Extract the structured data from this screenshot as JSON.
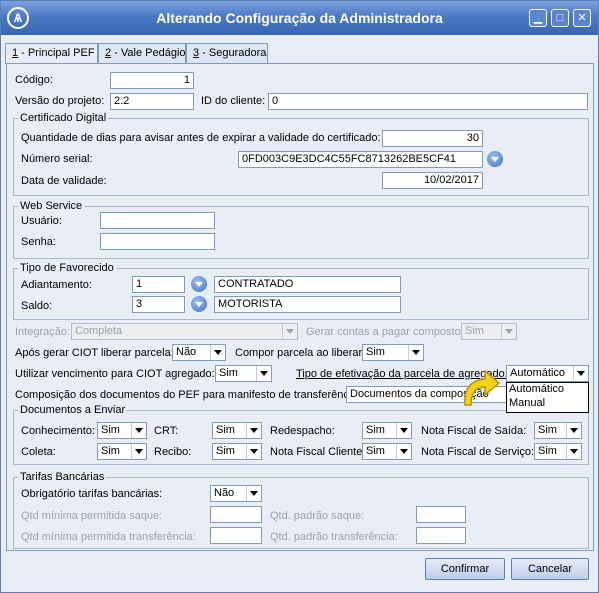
{
  "window": {
    "title": "Alterando Configuração da Administradora"
  },
  "tabs": [
    {
      "num": "1",
      "label": " - Principal PEF"
    },
    {
      "num": "2",
      "label": " - Vale Pedágio"
    },
    {
      "num": "3",
      "label": " - Seguradora"
    }
  ],
  "main": {
    "codigo_label": "Código:",
    "codigo_value": "1",
    "versao_label": "Versão do projeto:",
    "versao_value": "2.2",
    "idcliente_label": "ID do cliente:",
    "idcliente_value": "0"
  },
  "certificado": {
    "title": "Certificado Digital",
    "dias_label": "Quantidade de dias para avisar antes de expirar a validade do certificado:",
    "dias_value": "30",
    "serial_label": "Número serial:",
    "serial_value": "0FD003C9E3DC4C55FC8713262BE5CF41",
    "validade_label": "Data de validade:",
    "validade_value": "10/02/2017"
  },
  "webservice": {
    "title": "Web Service",
    "usuario_label": "Usuário:",
    "usuario_value": "",
    "senha_label": "Senha:",
    "senha_value": ""
  },
  "favorecido": {
    "title": "Tipo de Favorecido",
    "adiantamento_label": "Adiantamento:",
    "adiantamento_code": "1",
    "adiantamento_desc": "CONTRATADO",
    "saldo_label": "Saldo:",
    "saldo_code": "3",
    "saldo_desc": "MOTORISTA"
  },
  "opcoes": {
    "integracao_label": "Integração:",
    "integracao_value": "Completa",
    "gerar_contas_label": "Gerar contas a pagar composto:",
    "gerar_contas_value": "Sim",
    "apos_gerar_label": "Após gerar CIOT liberar parcela:",
    "apos_gerar_value": "Não",
    "compor_label": "Compor parcela ao liberar:",
    "compor_value": "Sim",
    "utilizar_label": "Utilizar vencimento para CIOT agregado:",
    "utilizar_value": "Sim",
    "tipo_efet_label": "Tipo de efetivação da parcela de agregado:",
    "tipo_efet_value": "Automático",
    "tipo_efet_options": [
      "Automático",
      "Manual"
    ],
    "composicao_label": "Composição dos documentos do PEF para manifesto de transferência:",
    "composicao_value": "Documentos da composição"
  },
  "documentos": {
    "title": "Documentos a Enviar",
    "conhecimento_label": "Conhecimento:",
    "conhecimento_value": "Sim",
    "crt_label": "CRT:",
    "crt_value": "Sim",
    "redespacho_label": "Redespacho:",
    "redespacho_value": "Sim",
    "nf_saida_label": "Nota Fiscal de Saída:",
    "nf_saida_value": "Sim",
    "coleta_label": "Coleta:",
    "coleta_value": "Sim",
    "recibo_label": "Recibo:",
    "recibo_value": "Sim",
    "nf_cliente_label": "Nota Fiscal Cliente:",
    "nf_cliente_value": "Sim",
    "nf_servico_label": "Nota Fiscal de Serviço:",
    "nf_servico_value": "Sim"
  },
  "tarifas": {
    "title": "Tarifas Bancárias",
    "obrigatorio_label": "Obrigatório tarifas bancárias:",
    "obrigatorio_value": "Não",
    "qtd_min_saque_label": "Qtd mínima permitida saque:",
    "qtd_pad_saque_label": "Qtd. padrão saque:",
    "qtd_min_transf_label": "Qtd mínima permitida transferência:",
    "qtd_pad_transf_label": "Qtd. padrão transferência:"
  },
  "buttons": {
    "confirmar": "Confirmar",
    "cancelar": "Cancelar"
  }
}
